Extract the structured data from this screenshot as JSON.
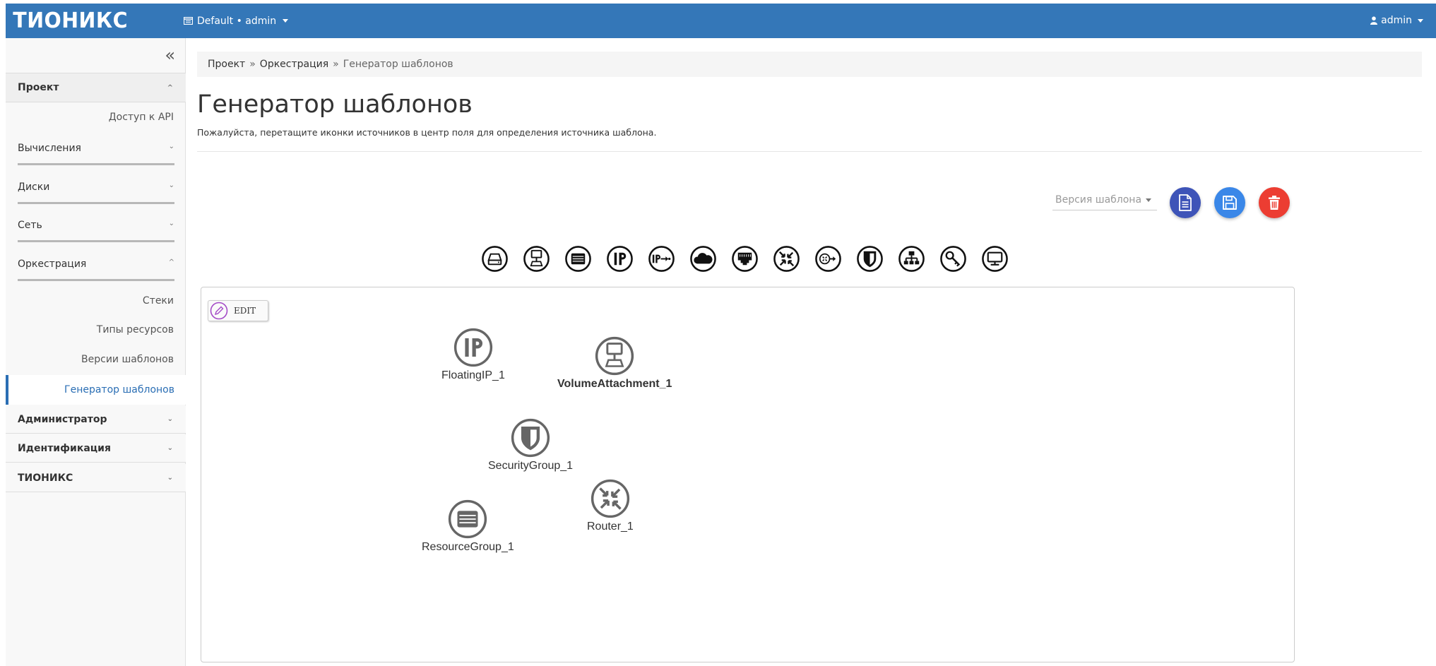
{
  "brand": "ТИОНИКС",
  "topbar": {
    "project_label": "Default • admin",
    "user_label": "admin"
  },
  "sidebar": {
    "sections": [
      {
        "label": "Проект"
      },
      {
        "label": "Администратор"
      },
      {
        "label": "Идентификация"
      },
      {
        "label": "ТИОНИКС"
      }
    ],
    "api_access": "Доступ к API",
    "groups": [
      {
        "label": "Вычисления"
      },
      {
        "label": "Диски"
      },
      {
        "label": "Сеть"
      },
      {
        "label": "Оркестрация"
      }
    ],
    "orchestration_items": [
      {
        "label": "Стеки"
      },
      {
        "label": "Типы ресурсов"
      },
      {
        "label": "Версии шаблонов"
      },
      {
        "label": "Генератор шаблонов"
      }
    ]
  },
  "breadcrumb": {
    "items": [
      "Проект",
      "Оркестрация",
      "Генератор шаблонов"
    ],
    "separator": "»"
  },
  "page": {
    "title": "Генератор шаблонов",
    "subtitle": "Пожалуйста, перетащите иконки источников в центр поля для определения источника шаблона."
  },
  "toolbar": {
    "version_placeholder": "Версия шаблона"
  },
  "resource_icons": [
    "volume-icon",
    "volume-attachment-icon",
    "resource-group-icon",
    "floating-ip-icon",
    "floating-ip-association-icon",
    "cloud-icon",
    "port-icon",
    "router-icon",
    "router-interface-icon",
    "security-group-icon",
    "network-icon",
    "key-icon",
    "server-icon"
  ],
  "canvas": {
    "edit_label": "EDIT",
    "nodes": [
      {
        "label": "FloatingIP_1",
        "icon": "floating-ip-icon"
      },
      {
        "label": "VolumeAttachment_1",
        "icon": "volume-attachment-icon"
      },
      {
        "label": "SecurityGroup_1",
        "icon": "security-group-icon"
      },
      {
        "label": "Router_1",
        "icon": "router-icon"
      },
      {
        "label": "ResourceGroup_1",
        "icon": "resource-group-icon"
      }
    ]
  },
  "colors": {
    "topbar": "#3477b8",
    "active_link": "#2a6eb4",
    "fab_file": "#3e54b8",
    "fab_save": "#3a87e8",
    "fab_delete": "#ec3d32",
    "edit_icon": "#a34ac6",
    "node_icon": "#666666"
  }
}
